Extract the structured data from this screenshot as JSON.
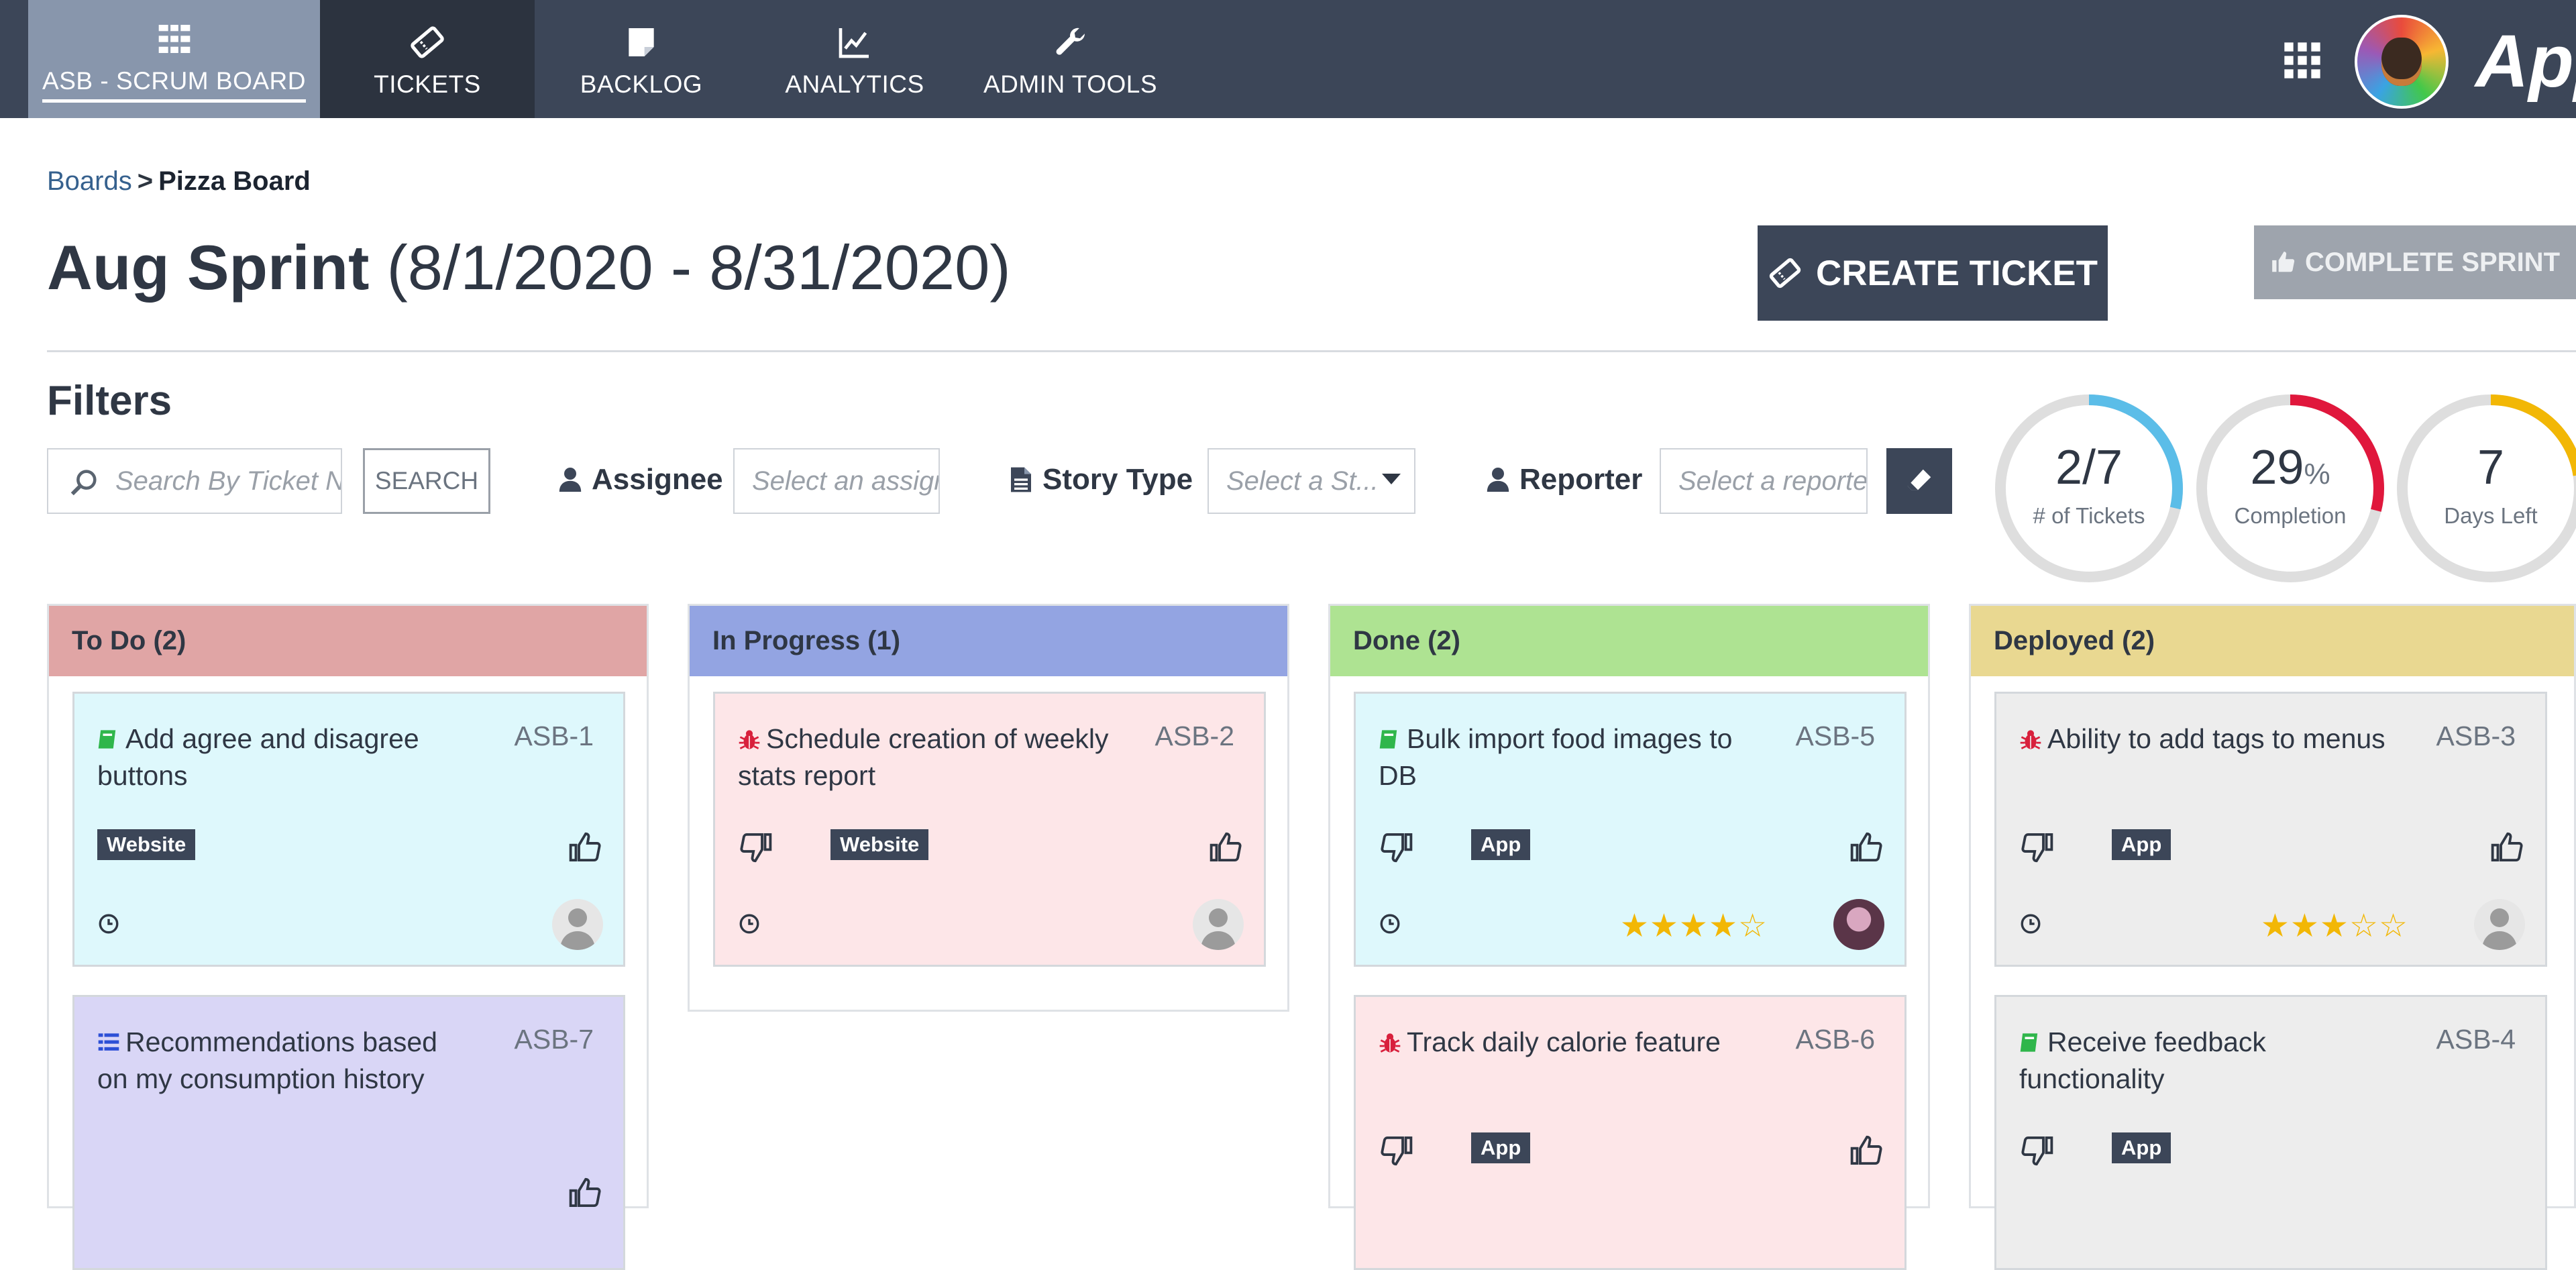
{
  "nav": {
    "items": [
      {
        "label": "ASB - SCRUM BOARD",
        "icon": "board-icon"
      },
      {
        "label": "TICKETS",
        "icon": "ticket-icon"
      },
      {
        "label": "BACKLOG",
        "icon": "note-icon"
      },
      {
        "label": "ANALYTICS",
        "icon": "chart-icon"
      },
      {
        "label": "ADMIN TOOLS",
        "icon": "wrench-icon"
      }
    ],
    "active": "ASB - SCRUM BOARD",
    "brand": "Appi"
  },
  "breadcrumb": {
    "link": "Boards",
    "separator": ">",
    "current": "Pizza Board"
  },
  "sprint": {
    "name": "Aug Sprint",
    "dates": "(8/1/2020 - 8/31/2020)"
  },
  "actions": {
    "create_ticket": "CREATE TICKET",
    "complete_sprint": "COMPLETE SPRINT"
  },
  "filters": {
    "heading": "Filters",
    "search_placeholder": "Search By Ticket N",
    "search_button": "SEARCH",
    "assignee_label": "Assignee",
    "assignee_placeholder": "Select an assignee",
    "story_type_label": "Story Type",
    "story_type_placeholder": "Select a St...",
    "reporter_label": "Reporter",
    "reporter_placeholder": "Select a reporter"
  },
  "stats": {
    "tickets": {
      "value": "2/7",
      "label": "# of Tickets",
      "fraction": 0.2857,
      "color": "#5bbde8"
    },
    "completion": {
      "value": "29",
      "unit": "%",
      "label": "Completion",
      "fraction": 0.29,
      "color": "#e0173c"
    },
    "days_left": {
      "value": "7",
      "label": "Days Left",
      "fraction": 0.226,
      "color": "#f2b705"
    }
  },
  "columns": [
    {
      "title": "To Do (2)",
      "color": "#e0a5a5",
      "cards": [
        {
          "id": "ASB-1",
          "title": "Add agree and disagree buttons",
          "type_icon": "story-icon",
          "tag": "Website",
          "rating": null
        },
        {
          "id": "ASB-7",
          "title": "Recommendations based on my consumption history",
          "type_icon": "epic-icon",
          "tag": null,
          "rating": null
        }
      ]
    },
    {
      "title": "In Progress (1)",
      "color": "#93a4e2",
      "cards": [
        {
          "id": "ASB-2",
          "title": "Schedule creation of weekly stats report",
          "type_icon": "bug-icon",
          "tag": "Website",
          "rating": null
        }
      ]
    },
    {
      "title": "Done (2)",
      "color": "#aee392",
      "cards": [
        {
          "id": "ASB-5",
          "title": "Bulk import food images to DB",
          "type_icon": "story-icon",
          "tag": "App",
          "rating": "★★★★☆"
        },
        {
          "id": "ASB-6",
          "title": "Track daily calorie feature",
          "type_icon": "bug-icon",
          "tag": "App",
          "rating": null
        }
      ]
    },
    {
      "title": "Deployed (2)",
      "color": "#e9d891",
      "cards": [
        {
          "id": "ASB-3",
          "title": "Ability to add tags to menus",
          "type_icon": "bug-icon",
          "tag": "App",
          "rating": "★★★☆☆"
        },
        {
          "id": "ASB-4",
          "title": "Receive feedback functionality",
          "type_icon": "story-icon",
          "tag": "App",
          "rating": null
        }
      ]
    }
  ]
}
